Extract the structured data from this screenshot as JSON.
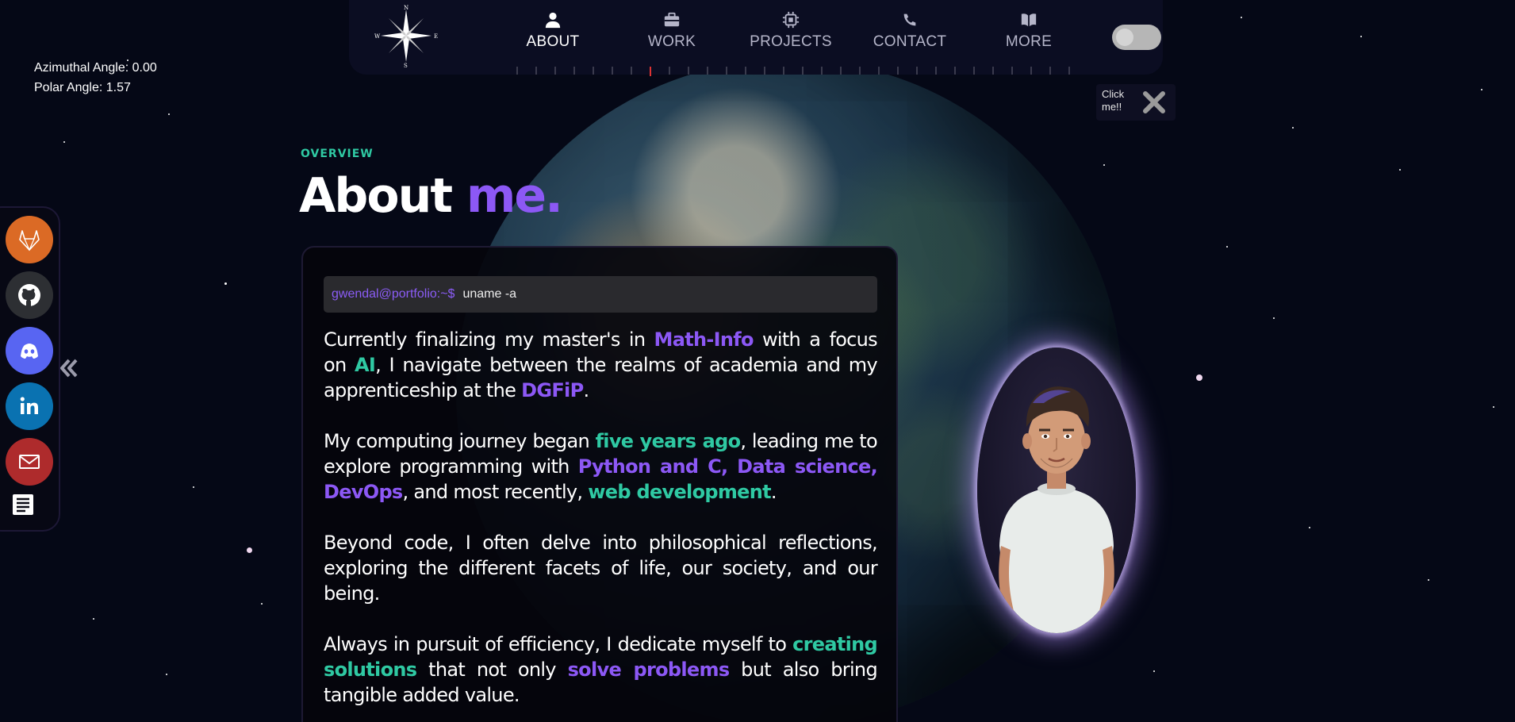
{
  "debug": {
    "azimuthal": "Azimuthal Angle: 0.00",
    "polar": "Polar Angle: 1.57"
  },
  "nav": {
    "items": [
      {
        "label": "ABOUT",
        "icon": "user-icon",
        "active": true
      },
      {
        "label": "WORK",
        "icon": "briefcase-icon",
        "active": false
      },
      {
        "label": "PROJECTS",
        "icon": "chip-icon",
        "active": false
      },
      {
        "label": "CONTACT",
        "icon": "phone-icon",
        "active": false
      },
      {
        "label": "MORE",
        "icon": "book-icon",
        "active": false
      }
    ],
    "compass": {
      "n": "N",
      "e": "E",
      "s": "S",
      "w": "W"
    }
  },
  "clickme": {
    "label": "Click me!!"
  },
  "social": [
    {
      "name": "gitlab",
      "color": "#db6a25"
    },
    {
      "name": "github",
      "color": "#2d2f33"
    },
    {
      "name": "discord",
      "color": "#5865f2"
    },
    {
      "name": "linkedin",
      "color": "#0a72b1"
    },
    {
      "name": "email",
      "color": "#ae2b2c"
    }
  ],
  "about": {
    "overview": "OVERVIEW",
    "title_main": "About ",
    "title_accent": "me.",
    "terminal": {
      "prompt": "gwendal@portfolio:~$",
      "command": "uname -a"
    },
    "paragraphs": {
      "p1": {
        "t1": "Currently finalizing my master's in ",
        "h1": "Math-Info",
        "t2": " with a focus on ",
        "h2": "AI",
        "t3": ", I navigate between the realms of academia and my apprenticeship at the ",
        "h3": "DGFiP",
        "t4": "."
      },
      "p2": {
        "t1": "My computing journey began ",
        "h1": "five years ago",
        "t2": ", leading me to explore programming with ",
        "h2": "Python and C, Data science, DevOps",
        "t3": ", and most recently, ",
        "h3": "web development",
        "t4": "."
      },
      "p3": {
        "t1": "Beyond code, I often delve into philosophical reflections, exploring the different facets of life, our society, and our being."
      },
      "p4": {
        "t1": "Always in pursuit of efficiency, I dedicate myself to ",
        "h1": "creating solutions",
        "t2": " that not only ",
        "h2": "solve problems",
        "t3": " but also bring tangible added value."
      }
    }
  },
  "colors": {
    "purple": "#8c58f5",
    "green": "#2fc9a3",
    "bg": "#050816"
  }
}
